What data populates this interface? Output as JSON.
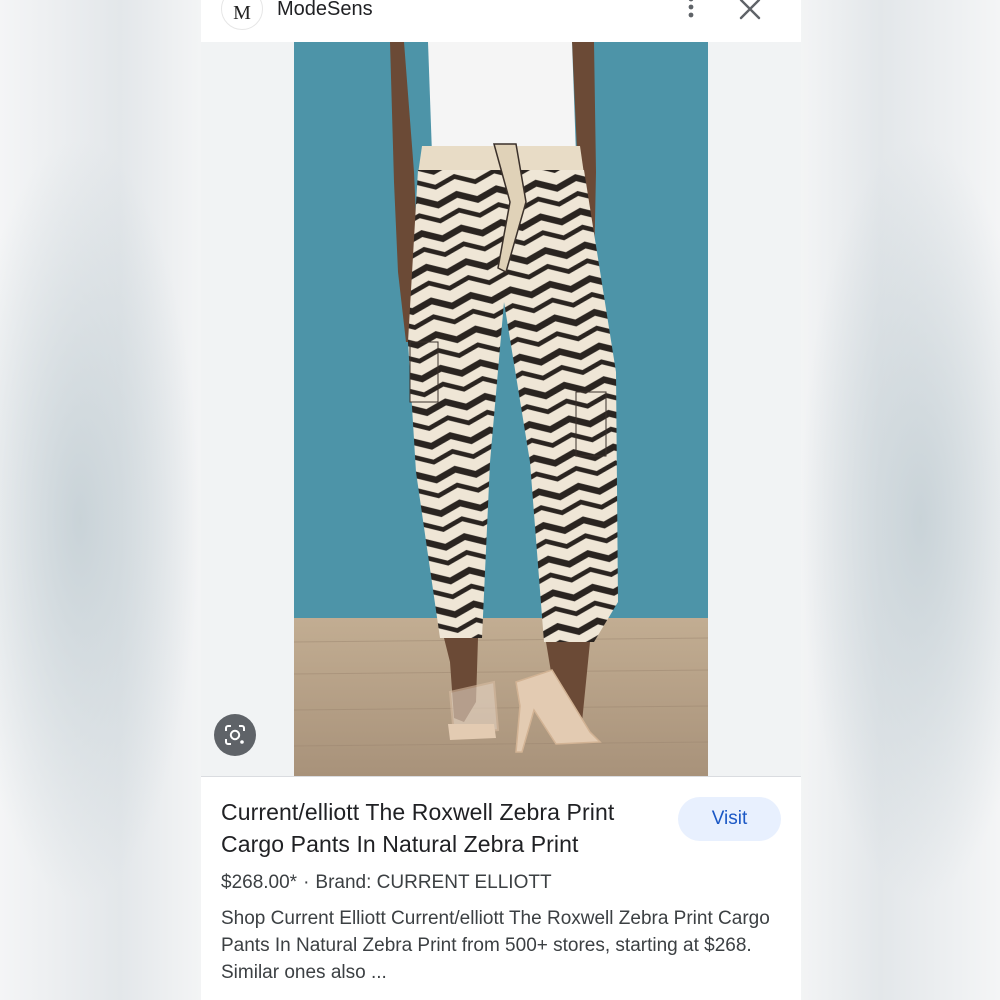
{
  "header": {
    "avatar_letter": "M",
    "site_name": "ModeSens"
  },
  "product": {
    "title_line1": "Current/elliott The Roxwell Zebra Print",
    "title_line2": "Cargo Pants In Natural Zebra Print",
    "visit_label": "Visit",
    "price": "$268.00*",
    "separator": "·",
    "brand": "Brand: CURRENT ELLIOTT",
    "description": "Shop Current Elliott Current/elliott The Roxwell Zebra Print Cargo Pants In Natural Zebra Print from 500+ stores, starting at $268. Similar ones also ..."
  },
  "icons": {
    "more": "more-vert-icon",
    "close": "close-icon",
    "lens": "google-lens-icon"
  },
  "colors": {
    "accent": "#1a57c5",
    "visit_bg": "#e8f0fe",
    "photo_wall": "#4d94a8",
    "photo_floor": "#b9a58c"
  }
}
